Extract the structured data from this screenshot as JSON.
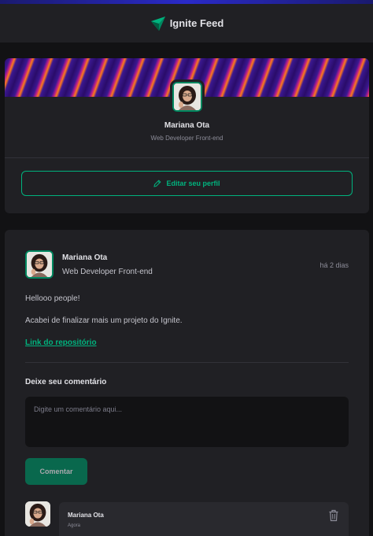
{
  "header": {
    "title": "Ignite Feed",
    "logo_icon": "ignite-logo-icon"
  },
  "colors": {
    "accent": "#00b37e",
    "accent_dark": "#00875f",
    "surface": "#202024",
    "background": "#121214"
  },
  "profile": {
    "name": "Mariana Ota",
    "role": "Web Developer Front-end",
    "edit_label": "Editar seu perfil",
    "edit_icon": "pencil-icon"
  },
  "post": {
    "author": {
      "name": "Mariana Ota",
      "role": "Web Developer Front-end"
    },
    "published": "há 2 dias",
    "content": [
      "Hellooo people!",
      "Acabei de finalizar mais um projeto do Ignite."
    ],
    "link_label": "Link do repositório",
    "comment_form": {
      "label": "Deixe seu comentário",
      "placeholder": "Digite um comentário aqui...",
      "submit_label": "Comentar"
    },
    "comments": [
      {
        "author": "Mariana Ota",
        "time": "Agora",
        "delete_icon": "trash-icon"
      }
    ]
  }
}
